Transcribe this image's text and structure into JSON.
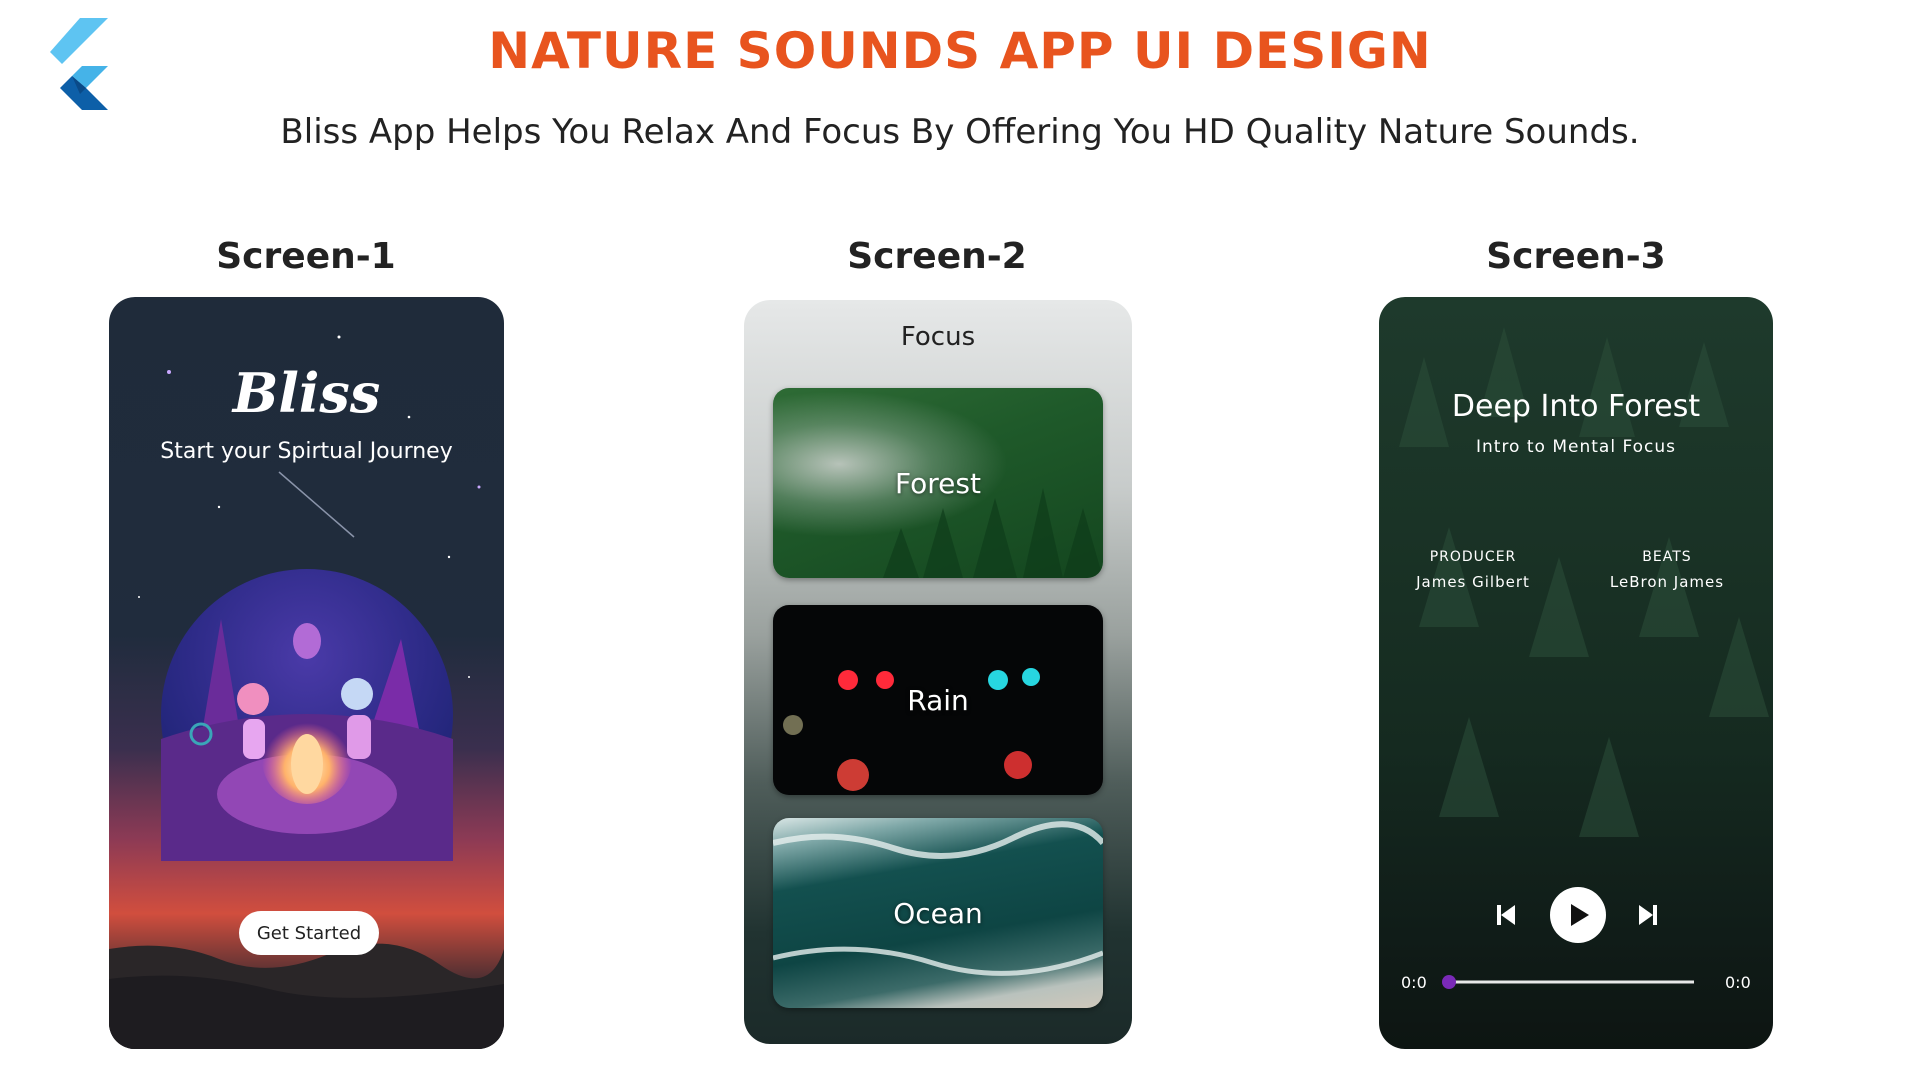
{
  "header": {
    "title": "NATURE SOUNDS APP UI DESIGN",
    "subtitle": "Bliss App Helps You Relax And Focus By Offering You HD Quality Nature Sounds.",
    "logo_icon": "flutter-logo",
    "title_color": "#e8541e"
  },
  "screens": [
    {
      "label": "Screen-1",
      "brand": "Bliss",
      "tagline": "Start your Spirtual Journey",
      "button_label": "Get Started"
    },
    {
      "label": "Screen-2",
      "title": "Focus",
      "cards": [
        {
          "label": "Forest"
        },
        {
          "label": "Rain"
        },
        {
          "label": "Ocean"
        }
      ]
    },
    {
      "label": "Screen-3",
      "track_title": "Deep Into Forest",
      "track_subtitle": "Intro to Mental Focus",
      "producer_key": "PRODUCER",
      "producer_value": "James Gilbert",
      "beats_key": "BEATS",
      "beats_value": "LeBron James",
      "time_elapsed": "0:0",
      "time_total": "0:0",
      "progress": 0,
      "accent": "#7a2ab8"
    }
  ]
}
